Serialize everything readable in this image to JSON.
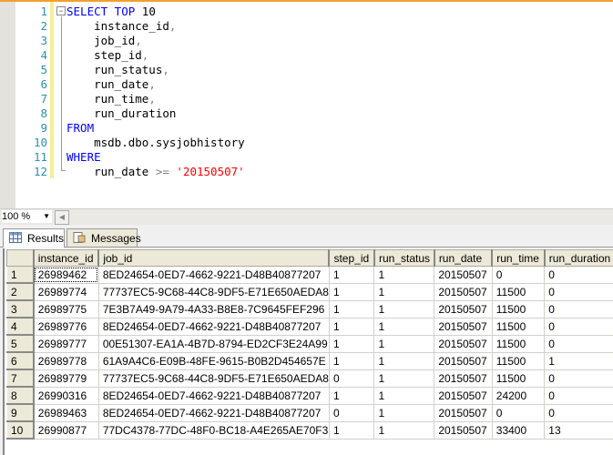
{
  "editor": {
    "lines": [
      {
        "n": "1",
        "parts": [
          [
            "kw",
            "SELECT TOP "
          ],
          [
            "",
            "10"
          ]
        ]
      },
      {
        "n": "2",
        "parts": [
          [
            "",
            "    instance_id"
          ],
          [
            "op",
            ","
          ]
        ]
      },
      {
        "n": "3",
        "parts": [
          [
            "",
            "    job_id"
          ],
          [
            "op",
            ","
          ]
        ]
      },
      {
        "n": "4",
        "parts": [
          [
            "",
            "    step_id"
          ],
          [
            "op",
            ","
          ]
        ]
      },
      {
        "n": "5",
        "parts": [
          [
            "",
            "    run_status"
          ],
          [
            "op",
            ","
          ]
        ]
      },
      {
        "n": "6",
        "parts": [
          [
            "",
            "    run_date"
          ],
          [
            "op",
            ","
          ]
        ]
      },
      {
        "n": "7",
        "parts": [
          [
            "",
            "    run_time"
          ],
          [
            "op",
            ","
          ]
        ]
      },
      {
        "n": "8",
        "parts": [
          [
            "",
            "    run_duration"
          ]
        ]
      },
      {
        "n": "9",
        "parts": [
          [
            "kw",
            "FROM"
          ]
        ]
      },
      {
        "n": "10",
        "parts": [
          [
            "",
            "    msdb.dbo.sysjobhistory"
          ]
        ]
      },
      {
        "n": "11",
        "parts": [
          [
            "kw",
            "WHERE"
          ]
        ]
      },
      {
        "n": "12",
        "parts": [
          [
            "",
            "    run_date "
          ],
          [
            "op",
            ">="
          ],
          [
            "str",
            " '20150507'"
          ]
        ]
      }
    ]
  },
  "zoom": {
    "value": "100 %"
  },
  "tabs": [
    {
      "label": "Results",
      "icon": "grid-icon"
    },
    {
      "label": "Messages",
      "icon": "messages-icon"
    }
  ],
  "grid": {
    "columns": [
      "instance_id",
      "job_id",
      "step_id",
      "run_status",
      "run_date",
      "run_time",
      "run_duration"
    ],
    "rows": [
      [
        "1",
        "26989462",
        "8ED24654-0ED7-4662-9221-D48B40877207",
        "1",
        "1",
        "20150507",
        "0",
        "0"
      ],
      [
        "2",
        "26989774",
        "77737EC5-9C68-44C8-9DF5-E71E650AEDA8",
        "1",
        "1",
        "20150507",
        "11500",
        "0"
      ],
      [
        "3",
        "26989775",
        "7E3B7A49-9A79-4A33-B8E8-7C9645FEF296",
        "1",
        "1",
        "20150507",
        "11500",
        "0"
      ],
      [
        "4",
        "26989776",
        "8ED24654-0ED7-4662-9221-D48B40877207",
        "1",
        "1",
        "20150507",
        "11500",
        "0"
      ],
      [
        "5",
        "26989777",
        "00E51307-EA1A-4B7D-8794-ED2CF3E24A99",
        "1",
        "1",
        "20150507",
        "11500",
        "0"
      ],
      [
        "6",
        "26989778",
        "61A9A4C6-E09B-48FE-9615-B0B2D454657E",
        "1",
        "1",
        "20150507",
        "11500",
        "1"
      ],
      [
        "7",
        "26989779",
        "77737EC5-9C68-44C8-9DF5-E71E650AEDA8",
        "0",
        "1",
        "20150507",
        "11500",
        "0"
      ],
      [
        "8",
        "26990316",
        "8ED24654-0ED7-4662-9221-D48B40877207",
        "1",
        "1",
        "20150507",
        "24200",
        "0"
      ],
      [
        "9",
        "26989463",
        "8ED24654-0ED7-4662-9221-D48B40877207",
        "0",
        "1",
        "20150507",
        "0",
        "0"
      ],
      [
        "10",
        "26990877",
        "77DC4378-77DC-48F0-BC18-A4E265AE70F3",
        "1",
        "1",
        "20150507",
        "33400",
        "13"
      ]
    ]
  }
}
